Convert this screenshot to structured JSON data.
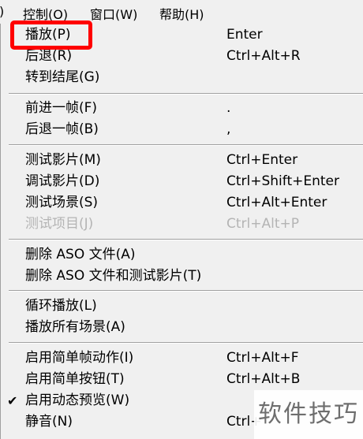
{
  "menubar": {
    "edge_paren": ")",
    "control": "控制(O)",
    "window": "窗口(W)",
    "help": "帮助(H)"
  },
  "menu": {
    "items": [
      {
        "label": "播放(P)",
        "shortcut": "Enter",
        "enabled": true
      },
      {
        "label": "后退(R)",
        "shortcut": "Ctrl+Alt+R",
        "enabled": true
      },
      {
        "label": "转到结尾(G)",
        "shortcut": "",
        "enabled": true
      },
      {
        "label": "前进一帧(F)",
        "shortcut": ".",
        "enabled": true
      },
      {
        "label": "后退一帧(B)",
        "shortcut": ",",
        "enabled": true
      },
      {
        "label": "测试影片(M)",
        "shortcut": "Ctrl+Enter",
        "enabled": true
      },
      {
        "label": "调试影片(D)",
        "shortcut": "Ctrl+Shift+Enter",
        "enabled": true
      },
      {
        "label": "测试场景(S)",
        "shortcut": "Ctrl+Alt+Enter",
        "enabled": true
      },
      {
        "label": "测试项目(J)",
        "shortcut": "Ctrl+Alt+P",
        "enabled": false
      },
      {
        "label": "删除 ASO 文件(A)",
        "shortcut": "",
        "enabled": true
      },
      {
        "label": "删除 ASO 文件和测试影片(T)",
        "shortcut": "",
        "enabled": true
      },
      {
        "label": "循环播放(L)",
        "shortcut": "",
        "enabled": true
      },
      {
        "label": "播放所有场景(A)",
        "shortcut": "",
        "enabled": true
      },
      {
        "label": "启用简单帧动作(I)",
        "shortcut": "Ctrl+Alt+F",
        "enabled": true
      },
      {
        "label": "启用简单按钮(T)",
        "shortcut": "Ctrl+Alt+B",
        "enabled": true
      },
      {
        "label": "启用动态预览(W)",
        "shortcut": "",
        "enabled": true,
        "checked": true,
        "check_glyph": "✔"
      },
      {
        "label": "静音(N)",
        "shortcut": "Ctrl+",
        "enabled": true
      }
    ]
  },
  "watermark": "软件技巧",
  "colors": {
    "highlight": "#ff0000",
    "menu_bg": "#f0f0f0",
    "disabled_text": "#b4b4b4"
  }
}
